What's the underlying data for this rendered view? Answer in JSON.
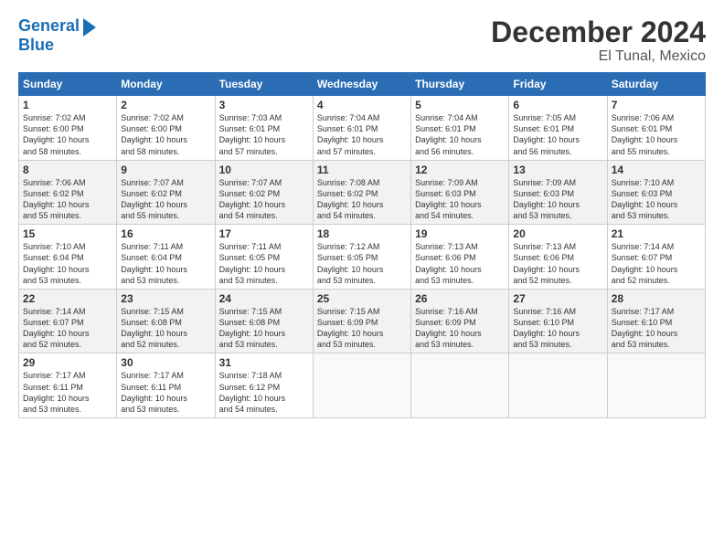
{
  "logo": {
    "line1": "General",
    "line2": "Blue"
  },
  "title": "December 2024",
  "subtitle": "El Tunal, Mexico",
  "days_of_week": [
    "Sunday",
    "Monday",
    "Tuesday",
    "Wednesday",
    "Thursday",
    "Friday",
    "Saturday"
  ],
  "weeks": [
    [
      {
        "day": "1",
        "info": "Sunrise: 7:02 AM\nSunset: 6:00 PM\nDaylight: 10 hours\nand 58 minutes."
      },
      {
        "day": "2",
        "info": "Sunrise: 7:02 AM\nSunset: 6:00 PM\nDaylight: 10 hours\nand 58 minutes."
      },
      {
        "day": "3",
        "info": "Sunrise: 7:03 AM\nSunset: 6:01 PM\nDaylight: 10 hours\nand 57 minutes."
      },
      {
        "day": "4",
        "info": "Sunrise: 7:04 AM\nSunset: 6:01 PM\nDaylight: 10 hours\nand 57 minutes."
      },
      {
        "day": "5",
        "info": "Sunrise: 7:04 AM\nSunset: 6:01 PM\nDaylight: 10 hours\nand 56 minutes."
      },
      {
        "day": "6",
        "info": "Sunrise: 7:05 AM\nSunset: 6:01 PM\nDaylight: 10 hours\nand 56 minutes."
      },
      {
        "day": "7",
        "info": "Sunrise: 7:06 AM\nSunset: 6:01 PM\nDaylight: 10 hours\nand 55 minutes."
      }
    ],
    [
      {
        "day": "8",
        "info": "Sunrise: 7:06 AM\nSunset: 6:02 PM\nDaylight: 10 hours\nand 55 minutes."
      },
      {
        "day": "9",
        "info": "Sunrise: 7:07 AM\nSunset: 6:02 PM\nDaylight: 10 hours\nand 55 minutes."
      },
      {
        "day": "10",
        "info": "Sunrise: 7:07 AM\nSunset: 6:02 PM\nDaylight: 10 hours\nand 54 minutes."
      },
      {
        "day": "11",
        "info": "Sunrise: 7:08 AM\nSunset: 6:02 PM\nDaylight: 10 hours\nand 54 minutes."
      },
      {
        "day": "12",
        "info": "Sunrise: 7:09 AM\nSunset: 6:03 PM\nDaylight: 10 hours\nand 54 minutes."
      },
      {
        "day": "13",
        "info": "Sunrise: 7:09 AM\nSunset: 6:03 PM\nDaylight: 10 hours\nand 53 minutes."
      },
      {
        "day": "14",
        "info": "Sunrise: 7:10 AM\nSunset: 6:03 PM\nDaylight: 10 hours\nand 53 minutes."
      }
    ],
    [
      {
        "day": "15",
        "info": "Sunrise: 7:10 AM\nSunset: 6:04 PM\nDaylight: 10 hours\nand 53 minutes."
      },
      {
        "day": "16",
        "info": "Sunrise: 7:11 AM\nSunset: 6:04 PM\nDaylight: 10 hours\nand 53 minutes."
      },
      {
        "day": "17",
        "info": "Sunrise: 7:11 AM\nSunset: 6:05 PM\nDaylight: 10 hours\nand 53 minutes."
      },
      {
        "day": "18",
        "info": "Sunrise: 7:12 AM\nSunset: 6:05 PM\nDaylight: 10 hours\nand 53 minutes."
      },
      {
        "day": "19",
        "info": "Sunrise: 7:13 AM\nSunset: 6:06 PM\nDaylight: 10 hours\nand 53 minutes."
      },
      {
        "day": "20",
        "info": "Sunrise: 7:13 AM\nSunset: 6:06 PM\nDaylight: 10 hours\nand 52 minutes."
      },
      {
        "day": "21",
        "info": "Sunrise: 7:14 AM\nSunset: 6:07 PM\nDaylight: 10 hours\nand 52 minutes."
      }
    ],
    [
      {
        "day": "22",
        "info": "Sunrise: 7:14 AM\nSunset: 6:07 PM\nDaylight: 10 hours\nand 52 minutes."
      },
      {
        "day": "23",
        "info": "Sunrise: 7:15 AM\nSunset: 6:08 PM\nDaylight: 10 hours\nand 52 minutes."
      },
      {
        "day": "24",
        "info": "Sunrise: 7:15 AM\nSunset: 6:08 PM\nDaylight: 10 hours\nand 53 minutes."
      },
      {
        "day": "25",
        "info": "Sunrise: 7:15 AM\nSunset: 6:09 PM\nDaylight: 10 hours\nand 53 minutes."
      },
      {
        "day": "26",
        "info": "Sunrise: 7:16 AM\nSunset: 6:09 PM\nDaylight: 10 hours\nand 53 minutes."
      },
      {
        "day": "27",
        "info": "Sunrise: 7:16 AM\nSunset: 6:10 PM\nDaylight: 10 hours\nand 53 minutes."
      },
      {
        "day": "28",
        "info": "Sunrise: 7:17 AM\nSunset: 6:10 PM\nDaylight: 10 hours\nand 53 minutes."
      }
    ],
    [
      {
        "day": "29",
        "info": "Sunrise: 7:17 AM\nSunset: 6:11 PM\nDaylight: 10 hours\nand 53 minutes."
      },
      {
        "day": "30",
        "info": "Sunrise: 7:17 AM\nSunset: 6:11 PM\nDaylight: 10 hours\nand 53 minutes."
      },
      {
        "day": "31",
        "info": "Sunrise: 7:18 AM\nSunset: 6:12 PM\nDaylight: 10 hours\nand 54 minutes."
      },
      null,
      null,
      null,
      null
    ]
  ]
}
